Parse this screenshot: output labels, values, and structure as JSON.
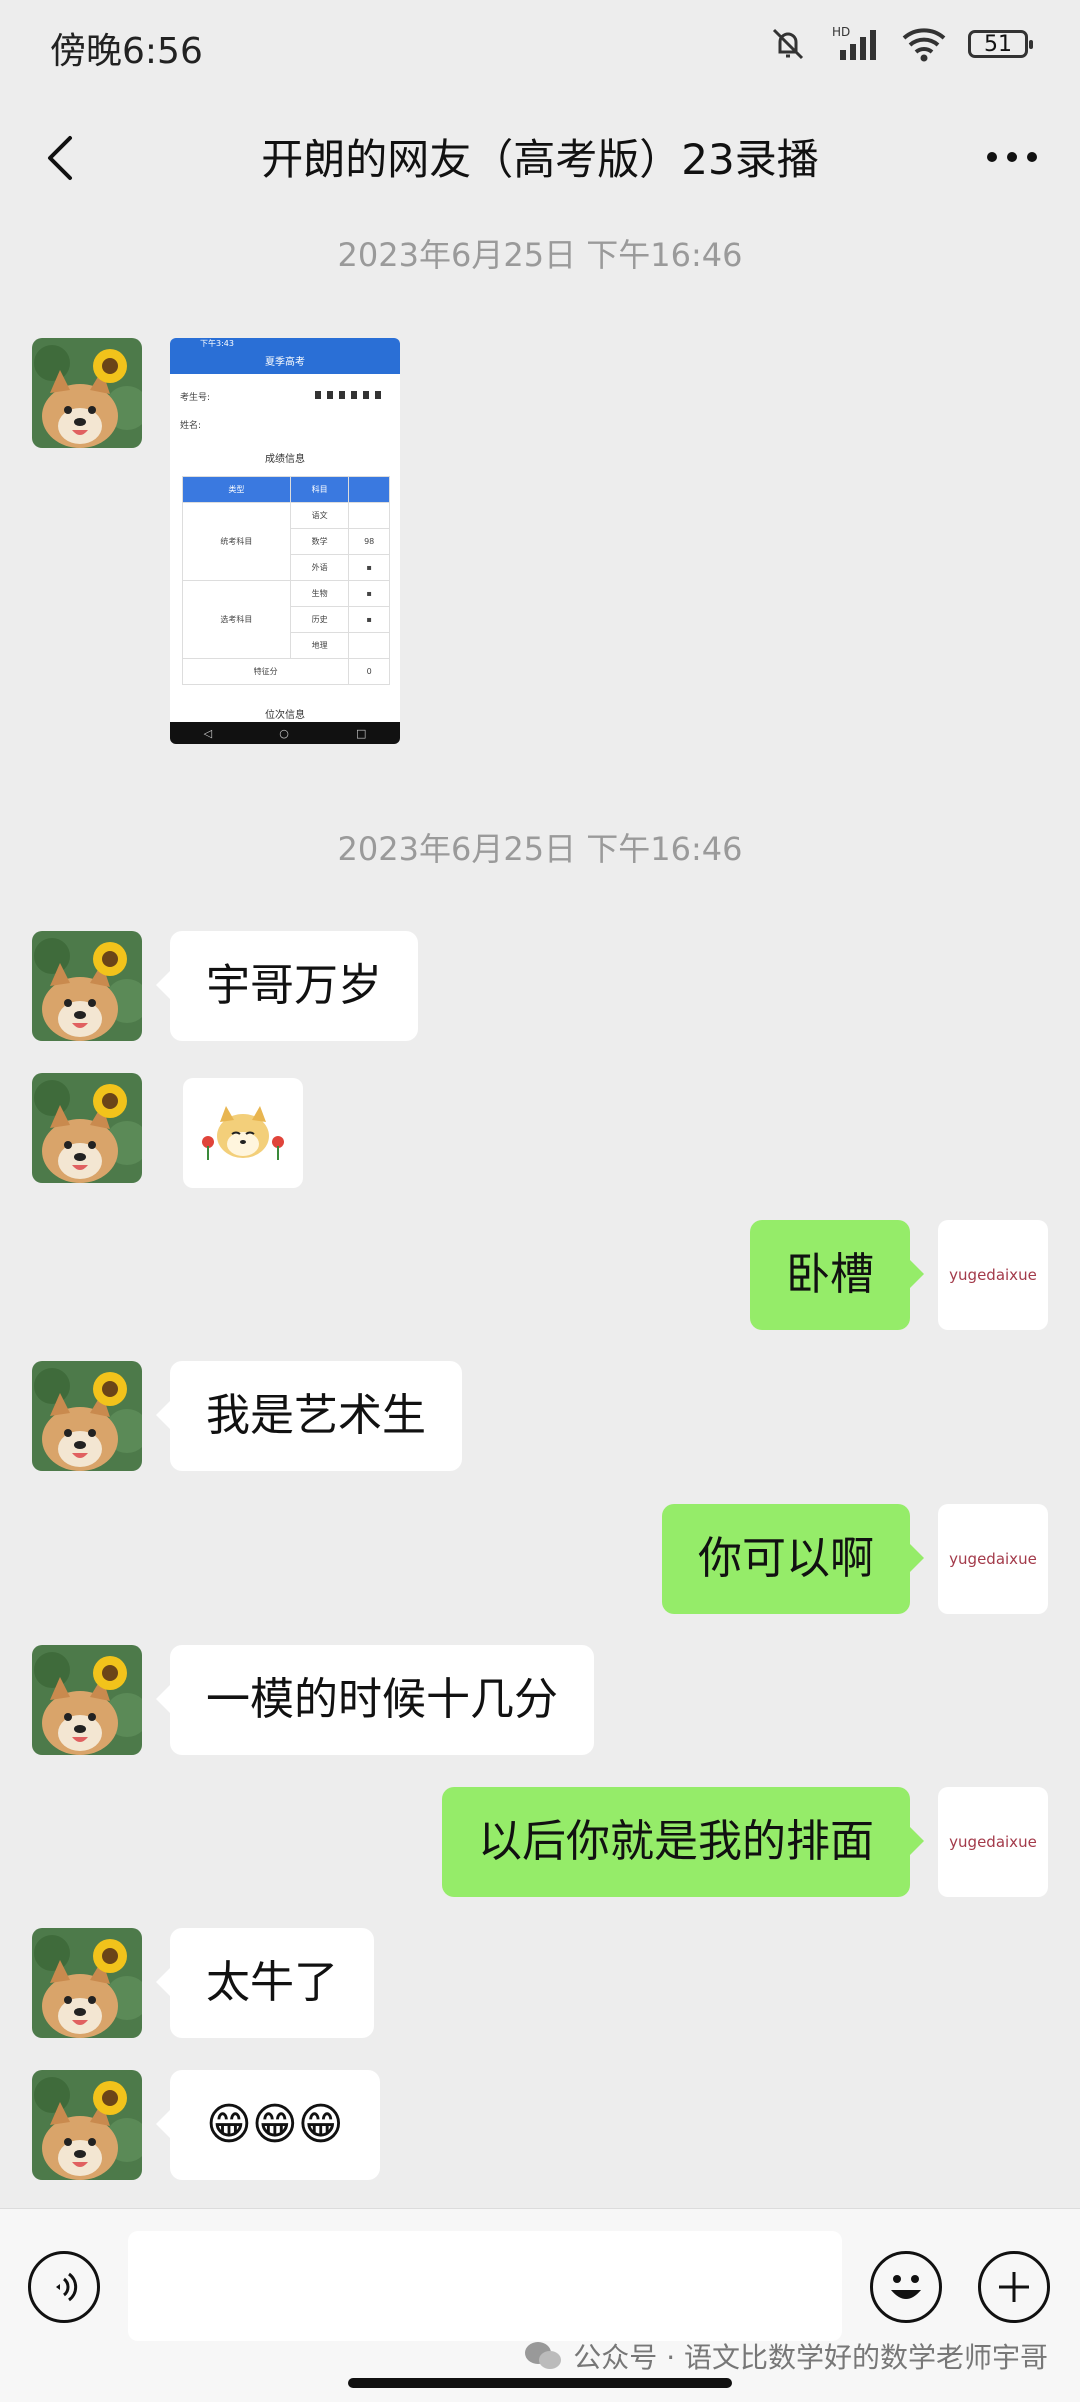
{
  "status": {
    "time": "傍晚6:56",
    "battery": "51",
    "hd": "HD"
  },
  "nav": {
    "title": "开朗的网友（高考版）23录播"
  },
  "timestamps": [
    "2023年6月25日 下午16:46",
    "2023年6月25日 下午16:46"
  ],
  "shot": {
    "status_time": "下午3:43",
    "nav_title": "夏季高考",
    "exam_no_label": "考生号:",
    "name_label": "姓名:",
    "section_title": "成绩信息",
    "headers": [
      "类型",
      "科目"
    ],
    "group_a": "统考科目",
    "group_b": "选考科目",
    "subjects": [
      "语文",
      "数学",
      "外语",
      "生物",
      "历史",
      "地理"
    ],
    "math_score": "98",
    "extra_label": "特征分",
    "extra_value": "0",
    "bottom_title": "位次信息",
    "nav_buttons": [
      "◁",
      "○",
      "□"
    ]
  },
  "messages": {
    "m1": "宇哥万岁",
    "m3": "卧槽",
    "m4": "我是艺术生",
    "m5": "你可以啊",
    "m6": "一模的时候十几分",
    "m7": "以后你就是我的排面",
    "m8": "太牛了",
    "m9": "😁😁😁"
  },
  "my_avatar_text": "yugedaixue",
  "watermark": "公众号 · 语文比数学好的数学老师宇哥"
}
